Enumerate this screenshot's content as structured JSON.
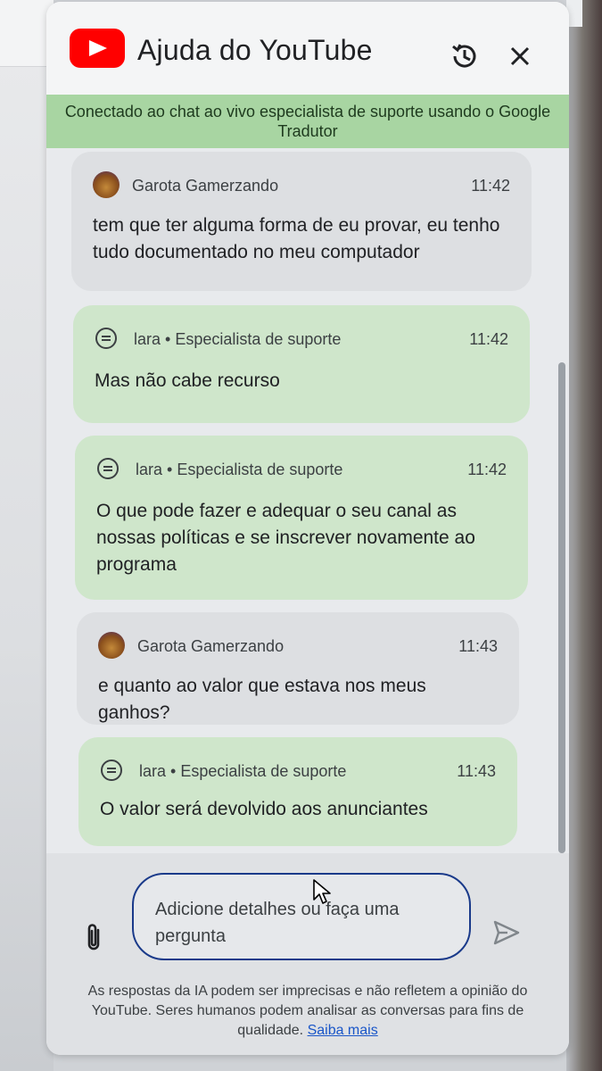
{
  "header": {
    "title": "Ajuda do YouTube"
  },
  "banner": {
    "text": "Conectado ao chat ao vivo especialista de suporte usando o Google Tradutor"
  },
  "messages": [
    {
      "sender": "Garota Gamerzando",
      "time": "11:42",
      "text": "tem que ter alguma forma de eu provar, eu tenho tudo documentado no meu computador"
    },
    {
      "sender": "lara • Especialista de suporte",
      "time": "11:42",
      "text": "Mas não cabe recurso"
    },
    {
      "sender": "lara • Especialista de suporte",
      "time": "11:42",
      "text": "O que pode fazer e adequar o seu canal as nossas políticas e se inscrever novamente ao programa"
    },
    {
      "sender": "Garota Gamerzando",
      "time": "11:43",
      "text": "e quanto ao valor que estava nos meus ganhos?"
    },
    {
      "sender": "lara • Especialista de suporte",
      "time": "11:43",
      "text": "O valor será devolvido aos anunciantes"
    }
  ],
  "composer": {
    "placeholder": "Adicione detalhes ou faça uma pergunta"
  },
  "disclaimer": {
    "text": "As respostas da IA podem ser imprecisas e não refletem a opinião do YouTube. Seres humanos podem analisar as conversas para fins de qualidade.",
    "link": "Saiba mais"
  },
  "colors": {
    "brand": "#ff0000",
    "banner": "#a8d5a2",
    "agent_bubble": "#cfe6cb",
    "user_bubble": "#dddfe2",
    "input_border": "#1a3a8a",
    "link": "#1a56c8"
  },
  "icons": [
    "youtube-logo-icon",
    "history-icon",
    "close-icon",
    "agent-icon",
    "attach-icon",
    "send-icon"
  ]
}
